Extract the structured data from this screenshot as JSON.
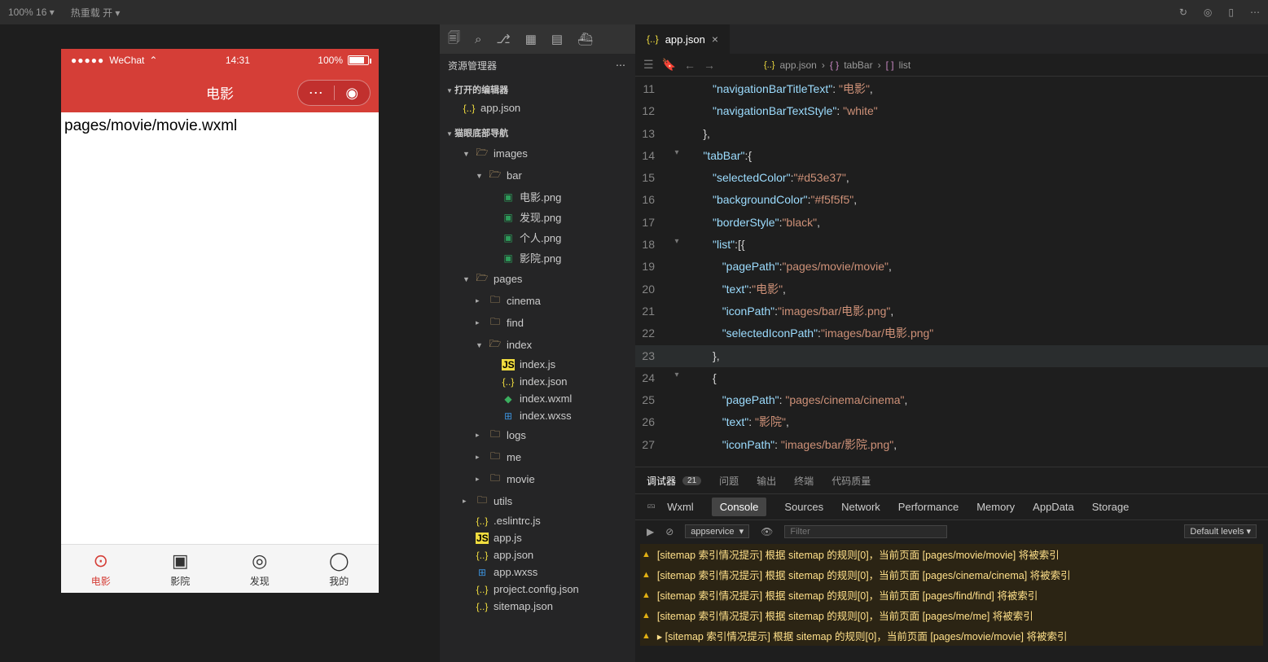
{
  "topbar": {
    "zoom": "100% 16 ▾",
    "hot_reload": "热重载 开 ▾"
  },
  "simulator": {
    "status_time": "14:31",
    "status_pct": "100%",
    "wechat_label": "WeChat",
    "app_title": "电影",
    "page_text": "pages/movie/movie.wxml",
    "tabs": [
      {
        "label": "电影",
        "active": true
      },
      {
        "label": "影院",
        "active": false
      },
      {
        "label": "发现",
        "active": false
      },
      {
        "label": "我的",
        "active": false
      }
    ]
  },
  "explorer": {
    "title": "资源管理器",
    "open_editors_label": "打开的编辑器",
    "open_file": "app.json",
    "project_label": "猫眼底部导航",
    "tree": [
      {
        "d": 1,
        "t": "folder-open",
        "chev": "▼",
        "name": "images"
      },
      {
        "d": 2,
        "t": "folder-open",
        "chev": "▼",
        "name": "bar"
      },
      {
        "d": 3,
        "t": "img",
        "name": "电影.png"
      },
      {
        "d": 3,
        "t": "img",
        "name": "发现.png"
      },
      {
        "d": 3,
        "t": "img",
        "name": "个人.png"
      },
      {
        "d": 3,
        "t": "img",
        "name": "影院.png"
      },
      {
        "d": 1,
        "t": "folder-open",
        "chev": "▼",
        "name": "pages"
      },
      {
        "d": 2,
        "t": "folder",
        "chev": "▸",
        "name": "cinema"
      },
      {
        "d": 2,
        "t": "folder",
        "chev": "▸",
        "name": "find"
      },
      {
        "d": 2,
        "t": "folder-open",
        "chev": "▼",
        "name": "index"
      },
      {
        "d": 3,
        "t": "js",
        "name": "index.js"
      },
      {
        "d": 3,
        "t": "json",
        "name": "index.json"
      },
      {
        "d": 3,
        "t": "wxml",
        "name": "index.wxml"
      },
      {
        "d": 3,
        "t": "wxss",
        "name": "index.wxss"
      },
      {
        "d": 2,
        "t": "folder",
        "chev": "▸",
        "name": "logs"
      },
      {
        "d": 2,
        "t": "folder",
        "chev": "▸",
        "name": "me"
      },
      {
        "d": 2,
        "t": "folder",
        "chev": "▸",
        "name": "movie"
      },
      {
        "d": 1,
        "t": "folder",
        "chev": "▸",
        "name": "utils"
      },
      {
        "d": 1,
        "t": "json",
        "name": ".eslintrc.js"
      },
      {
        "d": 1,
        "t": "js",
        "name": "app.js"
      },
      {
        "d": 1,
        "t": "json",
        "name": "app.json"
      },
      {
        "d": 1,
        "t": "wxss",
        "name": "app.wxss"
      },
      {
        "d": 1,
        "t": "json",
        "name": "project.config.json"
      },
      {
        "d": 1,
        "t": "json",
        "name": "sitemap.json"
      }
    ]
  },
  "tab": {
    "name": "app.json"
  },
  "breadcrumb": {
    "file": "app.json",
    "p1": "tabBar",
    "p2": "list"
  },
  "code": [
    {
      "n": 11,
      "i": 3,
      "tokens": [
        [
          "key",
          "\"navigationBarTitleText\""
        ],
        [
          "punc",
          ": "
        ],
        [
          "str",
          "\"电影\""
        ],
        [
          "punc",
          ","
        ]
      ]
    },
    {
      "n": 12,
      "i": 3,
      "tokens": [
        [
          "key",
          "\"navigationBarTextStyle\""
        ],
        [
          "punc",
          ": "
        ],
        [
          "str",
          "\"white\""
        ]
      ]
    },
    {
      "n": 13,
      "i": 2,
      "tokens": [
        [
          "brace",
          "}"
        ],
        [
          "punc",
          ","
        ]
      ]
    },
    {
      "n": 14,
      "i": 2,
      "fold": "▾",
      "tokens": [
        [
          "key",
          "\"tabBar\""
        ],
        [
          "punc",
          ":"
        ],
        [
          "brace",
          "{"
        ]
      ]
    },
    {
      "n": 15,
      "i": 3,
      "tokens": [
        [
          "key",
          "\"selectedColor\""
        ],
        [
          "punc",
          ":"
        ],
        [
          "str",
          "\"#d53e37\""
        ],
        [
          "punc",
          ","
        ]
      ]
    },
    {
      "n": 16,
      "i": 3,
      "tokens": [
        [
          "key",
          "\"backgroundColor\""
        ],
        [
          "punc",
          ":"
        ],
        [
          "str",
          "\"#f5f5f5\""
        ],
        [
          "punc",
          ","
        ]
      ]
    },
    {
      "n": 17,
      "i": 3,
      "tokens": [
        [
          "key",
          "\"borderStyle\""
        ],
        [
          "punc",
          ":"
        ],
        [
          "str",
          "\"black\""
        ],
        [
          "punc",
          ","
        ]
      ]
    },
    {
      "n": 18,
      "i": 3,
      "fold": "▾",
      "tokens": [
        [
          "key",
          "\"list\""
        ],
        [
          "punc",
          ":["
        ],
        [
          "brace",
          "{"
        ]
      ]
    },
    {
      "n": 19,
      "i": 4,
      "tokens": [
        [
          "key",
          "\"pagePath\""
        ],
        [
          "punc",
          ":"
        ],
        [
          "str",
          "\"pages/movie/movie\""
        ],
        [
          "punc",
          ","
        ]
      ]
    },
    {
      "n": 20,
      "i": 4,
      "tokens": [
        [
          "key",
          "\"text\""
        ],
        [
          "punc",
          ":"
        ],
        [
          "str",
          "\"电影\""
        ],
        [
          "punc",
          ","
        ]
      ]
    },
    {
      "n": 21,
      "i": 4,
      "tokens": [
        [
          "key",
          "\"iconPath\""
        ],
        [
          "punc",
          ":"
        ],
        [
          "str",
          "\"images/bar/电影.png\""
        ],
        [
          "punc",
          ","
        ]
      ]
    },
    {
      "n": 22,
      "i": 4,
      "tokens": [
        [
          "key",
          "\"selectedIconPath\""
        ],
        [
          "punc",
          ":"
        ],
        [
          "str",
          "\"images/bar/电影.png\""
        ]
      ]
    },
    {
      "n": 23,
      "i": 3,
      "hl": true,
      "tokens": [
        [
          "brace",
          "}"
        ],
        [
          "punc",
          ","
        ]
      ]
    },
    {
      "n": 24,
      "i": 3,
      "fold": "▾",
      "tokens": [
        [
          "brace",
          "{"
        ]
      ]
    },
    {
      "n": 25,
      "i": 4,
      "tokens": [
        [
          "key",
          "\"pagePath\""
        ],
        [
          "punc",
          ": "
        ],
        [
          "str",
          "\"pages/cinema/cinema\""
        ],
        [
          "punc",
          ","
        ]
      ]
    },
    {
      "n": 26,
      "i": 4,
      "tokens": [
        [
          "key",
          "\"text\""
        ],
        [
          "punc",
          ": "
        ],
        [
          "str",
          "\"影院\""
        ],
        [
          "punc",
          ","
        ]
      ]
    },
    {
      "n": 27,
      "i": 4,
      "tokens": [
        [
          "key",
          "\"iconPath\""
        ],
        [
          "punc",
          ": "
        ],
        [
          "str",
          "\"images/bar/影院.png\""
        ],
        [
          "punc",
          ","
        ]
      ]
    }
  ],
  "panel": {
    "tabs": [
      "调试器",
      "问题",
      "输出",
      "终端",
      "代码质量"
    ],
    "badge": "21",
    "devtool_tabs": [
      "Wxml",
      "Console",
      "Sources",
      "Network",
      "Performance",
      "Memory",
      "AppData",
      "Storage"
    ],
    "dt_active": "Console",
    "context": "appservice",
    "filter_placeholder": "Filter",
    "levels": "Default levels ▾",
    "logs": [
      "[sitemap 索引情况提示] 根据 sitemap 的规则[0]，当前页面 [pages/movie/movie] 将被索引",
      "[sitemap 索引情况提示] 根据 sitemap 的规则[0]，当前页面 [pages/cinema/cinema] 将被索引",
      "[sitemap 索引情况提示] 根据 sitemap 的规则[0]，当前页面 [pages/find/find] 将被索引",
      "[sitemap 索引情况提示] 根据 sitemap 的规则[0]，当前页面 [pages/me/me] 将被索引",
      "[sitemap 索引情况提示] 根据 sitemap 的规则[0]，当前页面 [pages/movie/movie] 将被索引"
    ]
  }
}
